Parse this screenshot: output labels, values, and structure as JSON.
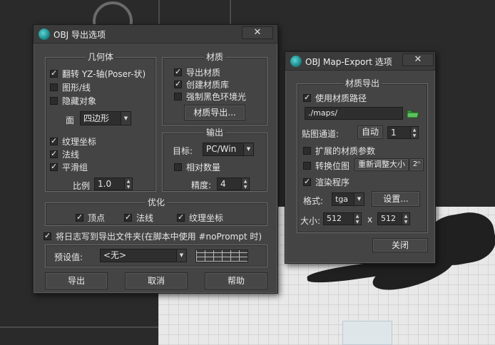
{
  "obj_dialog": {
    "title": "OBJ 导出选项",
    "close": "✕",
    "geometry": {
      "title": "几何体",
      "flip_yz": "翻转 YZ-轴(Poser-状)",
      "shapes": "图形/线",
      "hidden": "隐藏对象",
      "face_label": "面",
      "face_value": "四边形",
      "texcoords": "纹理坐标",
      "normals": "法线",
      "smoothing": "平滑组",
      "scale_label": "比例",
      "scale_value": "1.0"
    },
    "material": {
      "title": "材质",
      "export": "导出材质",
      "create_lib": "创建材质库",
      "force_black": "强制黑色环境光",
      "material_export_btn": "材质导出..."
    },
    "output": {
      "title": "输出",
      "target_label": "目标:",
      "target_value": "PC/Win",
      "relative": "相对数量",
      "precision_label": "精度:",
      "precision_value": "4"
    },
    "optimize": {
      "title": "优化",
      "vertices": "顶点",
      "normals": "法线",
      "texcoords": "纹理坐标"
    },
    "log": "将日志写到导出文件夹(在脚本中使用 #noPrompt 时)",
    "preset_label": "预设值:",
    "preset_value": "<无>",
    "buttons": {
      "export": "导出",
      "cancel": "取消",
      "help": "帮助"
    }
  },
  "map_dialog": {
    "title": "OBJ Map-Export 选项",
    "close": "✕",
    "group_title": "材质导出",
    "use_path": "使用材质路径",
    "path_value": "./maps/",
    "channel_label": "贴图通道:",
    "channel_auto": "自动",
    "channel_value": "1",
    "extended": "扩展的材质参数",
    "convert": "转换位图",
    "resize_btn": "重新调整大小",
    "pow2": "2ⁿ",
    "render": "渲染程序",
    "format_label": "格式:",
    "format_value": "tga",
    "settings_btn": "设置...",
    "size_label": "大小:",
    "size_w": "512",
    "size_x": "x",
    "size_h": "512",
    "close_btn": "关闭"
  }
}
